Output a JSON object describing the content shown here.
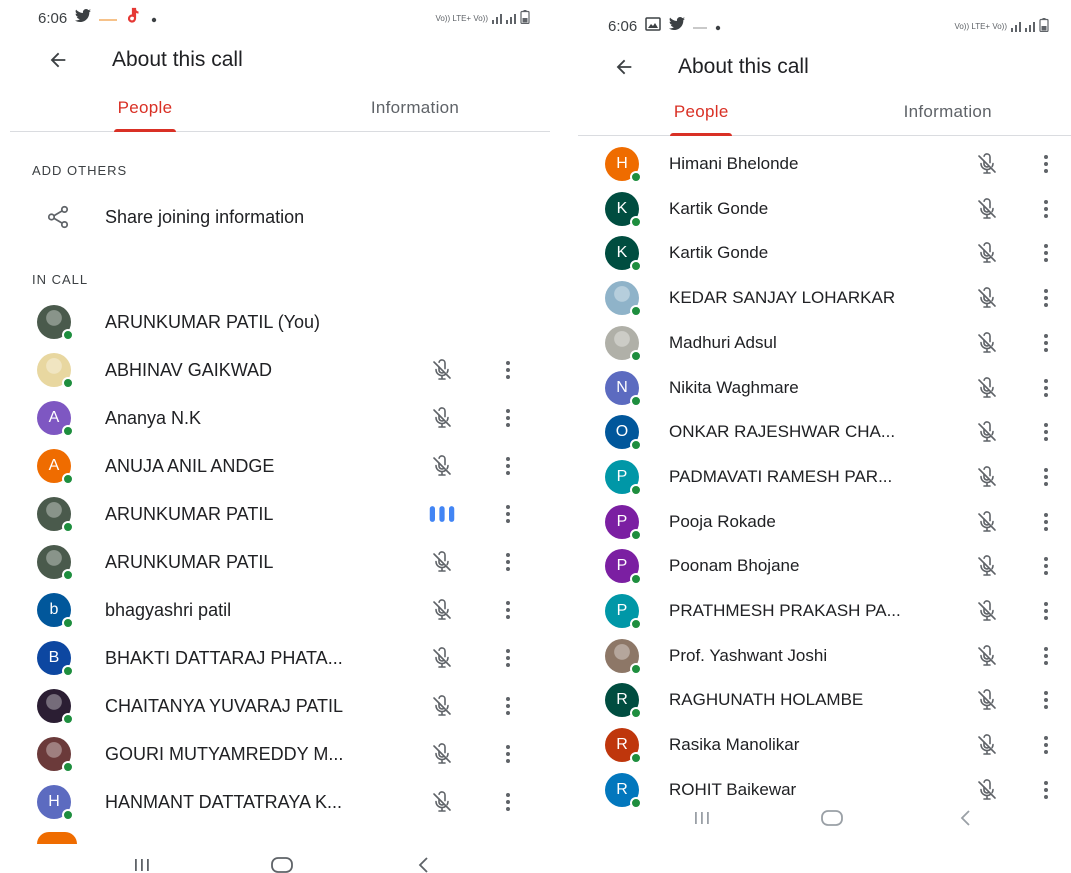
{
  "colors": {
    "accent": "#d93025",
    "online": "#1e8e3e",
    "speaking": "#4285f4"
  },
  "left": {
    "status": {
      "time": "6:06",
      "network": "Vo)) LTE+ Vo))"
    },
    "appbar": {
      "title": "About this call",
      "back_icon": "arrow-back-icon"
    },
    "tabs": [
      {
        "label": "People",
        "active": true
      },
      {
        "label": "Information",
        "active": false
      }
    ],
    "add_others_label": "ADD OTHERS",
    "share_label": "Share joining information",
    "in_call_label": "IN CALL",
    "people": [
      {
        "name": "ARUNKUMAR PATIL (You)",
        "avatar": "photo",
        "color": "#4a5a4c",
        "mic": "none"
      },
      {
        "name": "ABHINAV GAIKWAD",
        "avatar": "photo",
        "color": "#e8d7a0",
        "mic": "muted"
      },
      {
        "name": "Ananya N.K",
        "avatar": "A",
        "color": "#7e57c2",
        "mic": "muted"
      },
      {
        "name": "ANUJA ANIL ANDGE",
        "avatar": "A",
        "color": "#ef6c00",
        "mic": "muted"
      },
      {
        "name": "ARUNKUMAR PATIL",
        "avatar": "photo",
        "color": "#4a5a4c",
        "mic": "speaking"
      },
      {
        "name": "ARUNKUMAR PATIL",
        "avatar": "photo",
        "color": "#4a5a4c",
        "mic": "muted"
      },
      {
        "name": "bhagyashri patil",
        "avatar": "b",
        "color": "#01579b",
        "mic": "muted"
      },
      {
        "name": "BHAKTI DATTARAJ PHATA...",
        "avatar": "B",
        "color": "#0d47a1",
        "mic": "muted"
      },
      {
        "name": "CHAITANYA YUVARAJ PATIL",
        "avatar": "photo",
        "color": "#2b1e33",
        "mic": "muted"
      },
      {
        "name": "GOURI MUTYAMREDDY M...",
        "avatar": "photo",
        "color": "#6b3a3a",
        "mic": "muted"
      },
      {
        "name": "HANMANT DATTATRAYA K...",
        "avatar": "H",
        "color": "#5c6bc0",
        "mic": "muted"
      }
    ],
    "nav": [
      "recent-apps-icon",
      "home-icon",
      "back-nav-icon"
    ]
  },
  "right": {
    "status": {
      "time": "6:06",
      "network": "Vo)) LTE+ Vo))"
    },
    "appbar": {
      "title": "About this call",
      "back_icon": "arrow-back-icon"
    },
    "tabs": [
      {
        "label": "People",
        "active": true
      },
      {
        "label": "Information",
        "active": false
      }
    ],
    "people": [
      {
        "name": "Himani Bhelonde",
        "avatar": "H",
        "color": "#ef6c00",
        "mic": "muted"
      },
      {
        "name": "Kartik Gonde",
        "avatar": "K",
        "color": "#004d40",
        "mic": "muted"
      },
      {
        "name": "Kartik Gonde",
        "avatar": "K",
        "color": "#004d40",
        "mic": "muted"
      },
      {
        "name": "KEDAR SANJAY LOHARKAR",
        "avatar": "photo",
        "color": "#8fb3c9",
        "mic": "muted"
      },
      {
        "name": "Madhuri Adsul",
        "avatar": "photo",
        "color": "#b0b0a8",
        "mic": "muted"
      },
      {
        "name": "Nikita Waghmare",
        "avatar": "N",
        "color": "#5c6bc0",
        "mic": "muted"
      },
      {
        "name": "ONKAR RAJESHWAR CHA...",
        "avatar": "O",
        "color": "#01579b",
        "mic": "muted"
      },
      {
        "name": "PADMAVATI RAMESH PAR...",
        "avatar": "P",
        "color": "#0097a7",
        "mic": "muted"
      },
      {
        "name": "Pooja Rokade",
        "avatar": "P",
        "color": "#7b1fa2",
        "mic": "muted"
      },
      {
        "name": "Poonam Bhojane",
        "avatar": "P",
        "color": "#7b1fa2",
        "mic": "muted"
      },
      {
        "name": "PRATHMESH PRAKASH PA...",
        "avatar": "P",
        "color": "#0097a7",
        "mic": "muted"
      },
      {
        "name": "Prof. Yashwant Joshi",
        "avatar": "photo",
        "color": "#8d7767",
        "mic": "muted"
      },
      {
        "name": "RAGHUNATH HOLAMBE",
        "avatar": "R",
        "color": "#004d40",
        "mic": "muted"
      },
      {
        "name": "Rasika Manolikar",
        "avatar": "R",
        "color": "#bf360c",
        "mic": "muted"
      },
      {
        "name": "ROHIT Baikewar",
        "avatar": "R",
        "color": "#0277bd",
        "mic": "muted"
      }
    ],
    "nav": [
      "recent-apps-icon",
      "home-icon",
      "back-nav-icon"
    ]
  }
}
